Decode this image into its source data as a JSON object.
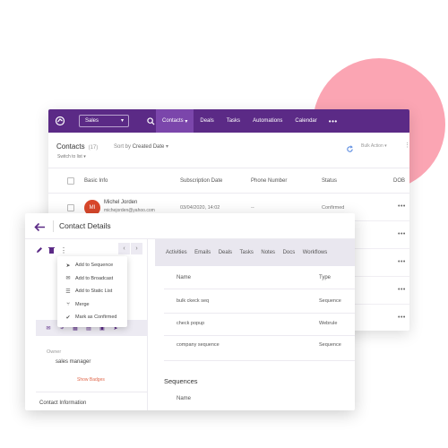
{
  "colors": {
    "brand": "#5b2a86",
    "brand_active": "#7b46ab",
    "accent_circle": "#fba5b3",
    "avatar": "#d9472b",
    "link_orange": "#e0694d"
  },
  "back_window": {
    "nav": {
      "module": "Sales",
      "items": [
        "Contacts",
        "Deals",
        "Tasks",
        "Automations",
        "Calendar"
      ],
      "active": "Contacts",
      "more": "•••"
    },
    "subbar": {
      "title": "Contacts",
      "count": "(17)",
      "switch_list": "Switch to list",
      "sort_label": "Sort by",
      "sort_value": "Created Date",
      "bulk_action": "Bulk Action"
    },
    "columns": [
      "Basic Info",
      "Subscription Date",
      "Phone Number",
      "Status",
      "DOB"
    ],
    "rows": [
      {
        "initials": "MI",
        "name": "Michel Jorden",
        "email": "michejorden@yahoo.com",
        "date": "03/04/2020, 14:02",
        "phone": "--",
        "status": "Confirmed"
      }
    ],
    "row_more": "•••"
  },
  "front_window": {
    "title": "Contact Details",
    "menu": [
      {
        "icon": "send-icon",
        "label": "Add to Sequence"
      },
      {
        "icon": "mail-icon",
        "label": "Add to Broadcast"
      },
      {
        "icon": "list-icon",
        "label": "Add to Static List"
      },
      {
        "icon": "merge-icon",
        "label": "Merge"
      },
      {
        "icon": "check-icon",
        "label": "Mark as Confirmed"
      }
    ],
    "owner_label": "Owner",
    "owner_value": "sales manager",
    "show_badges": "Show Badges",
    "contact_info": "Contact Information",
    "tabs": [
      "Activities",
      "Emails",
      "Deals",
      "Tasks",
      "Notes",
      "Docs",
      "Workflows"
    ],
    "table_headers": [
      "Name",
      "Type"
    ],
    "table_rows": [
      {
        "name": "bulk ckeck seq",
        "type": "Sequence"
      },
      {
        "name": "check popup",
        "type": "Webrule"
      },
      {
        "name": "company sequence",
        "type": "Sequence"
      }
    ],
    "sequences_title": "Sequences",
    "sequences_header": "Name"
  }
}
